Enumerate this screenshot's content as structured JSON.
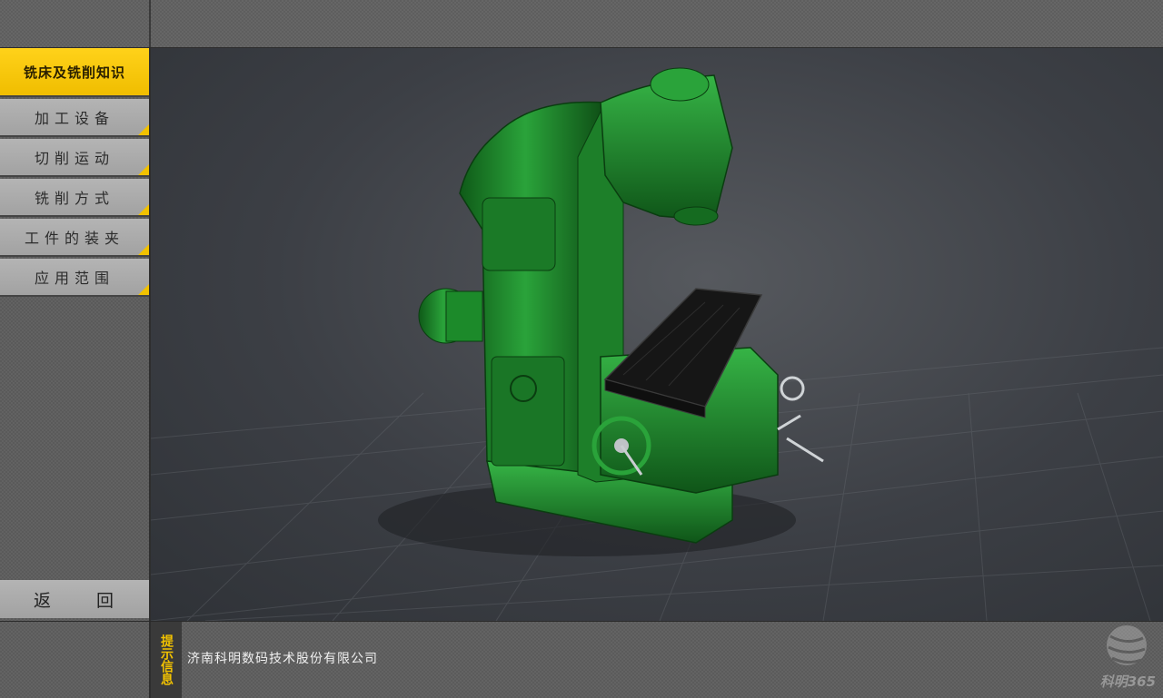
{
  "sidebar": {
    "active": {
      "label": "铣床及铣削知识"
    },
    "items": [
      {
        "label": "加工设备"
      },
      {
        "label": "切削运动"
      },
      {
        "label": "铣削方式"
      },
      {
        "label": "工件的装夹"
      },
      {
        "label": "应用范围"
      }
    ],
    "back_label": "返 回"
  },
  "viewport": {
    "model": "milling-machine-3d-model",
    "model_color": "#1f8a2c"
  },
  "bottom": {
    "hint_label": "提示信息",
    "hint_text": "济南科明数码技术股份有限公司",
    "logo_text": "科明365"
  },
  "colors": {
    "accent": "#f2c200",
    "panel": "#a8a8a8"
  }
}
